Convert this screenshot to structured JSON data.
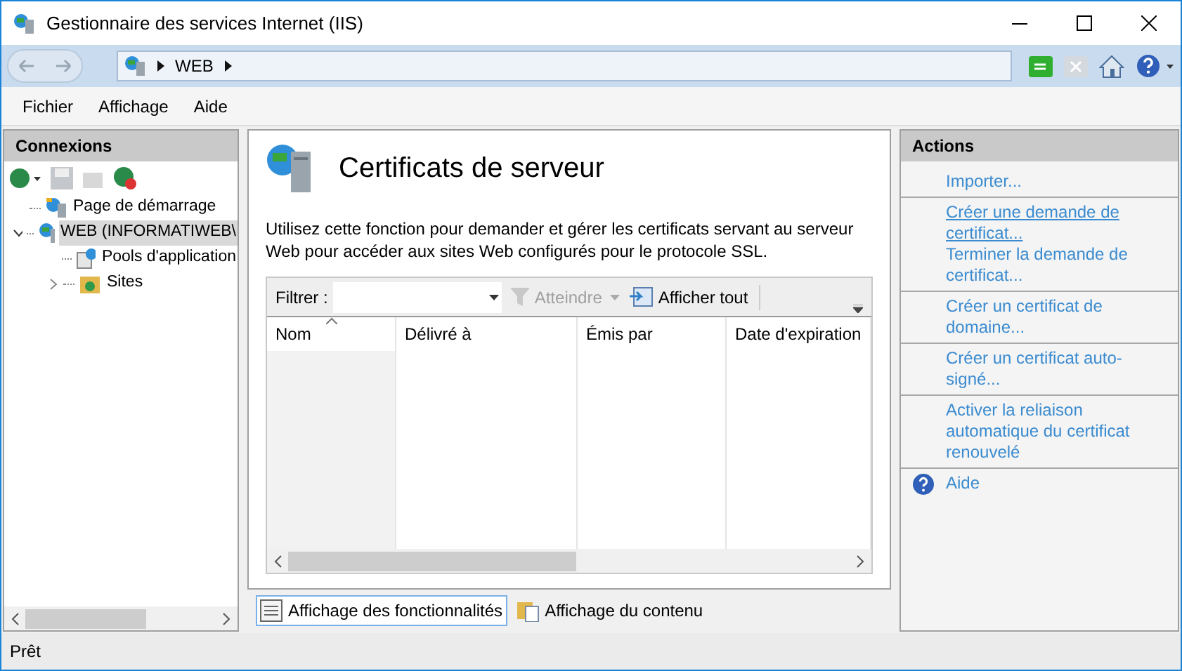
{
  "window": {
    "title": "Gestionnaire des services Internet (IIS)"
  },
  "address_bar": {
    "path": [
      "WEB"
    ]
  },
  "menu": [
    "Fichier",
    "Affichage",
    "Aide"
  ],
  "connections": {
    "title": "Connexions",
    "tree": [
      {
        "label": "Page de démarrage",
        "kind": "start",
        "selected": false
      },
      {
        "label": "WEB (INFORMATIWEB\\",
        "kind": "server",
        "selected": true,
        "expanded": true,
        "children": [
          {
            "label": "Pools d'application",
            "kind": "pools",
            "selected": false
          },
          {
            "label": "Sites",
            "kind": "sites",
            "selected": false,
            "expanded": false
          }
        ]
      }
    ]
  },
  "feature": {
    "title": "Certificats de serveur",
    "description": "Utilisez cette fonction pour demander et gérer les certificats servant au serveur Web pour accéder aux sites Web configurés pour le protocole SSL.",
    "filter_label": "Filtrer :",
    "go_button": "Atteindre",
    "show_all_button": "Afficher tout",
    "table": {
      "columns": [
        {
          "label": "Nom",
          "sorted": true
        },
        {
          "label": "Délivré à",
          "sorted": false
        },
        {
          "label": "Émis par",
          "sorted": false
        },
        {
          "label": "Date d'expiration",
          "sorted": false
        }
      ]
    }
  },
  "view_tabs": [
    {
      "label": "Affichage des fonctionnalités",
      "selected": true
    },
    {
      "label": "Affichage du contenu",
      "selected": false
    }
  ],
  "actions": {
    "title": "Actions",
    "groups": [
      [
        {
          "label": "Importer...",
          "hover": false
        }
      ],
      [
        {
          "label": "Créer une demande de certificat...",
          "hover": true
        },
        {
          "label": "Terminer la demande de certificat...",
          "hover": false
        }
      ],
      [
        {
          "label": "Créer un certificat de domaine...",
          "hover": false
        }
      ],
      [
        {
          "label": "Créer un certificat auto-signé...",
          "hover": false
        }
      ],
      [
        {
          "label": "Activer la reliaison automatique du certificat renouvelé",
          "hover": false
        }
      ],
      [
        {
          "label": "Aide",
          "hover": false,
          "kind": "help"
        }
      ]
    ]
  },
  "status_bar": {
    "text": "Prêt"
  }
}
